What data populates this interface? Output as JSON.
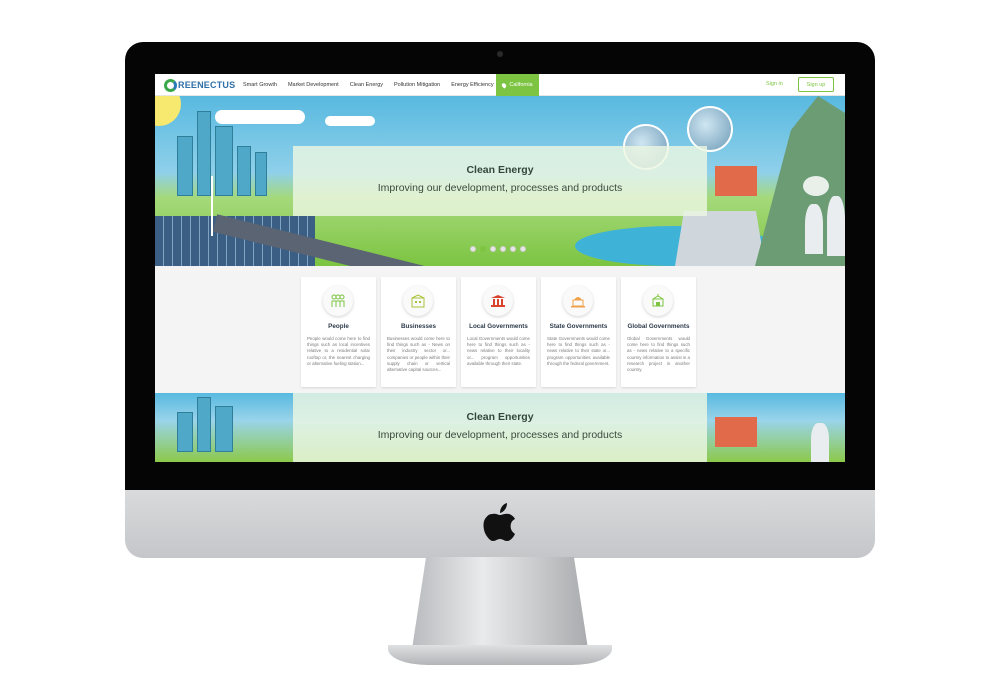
{
  "brand": {
    "logo_text": "REENECTUS",
    "accent": "#7cc441",
    "logo_blue": "#2f6fa8"
  },
  "nav": {
    "links": [
      "Smart Growth",
      "Market Development",
      "Clean Energy",
      "Pollution Mitigation",
      "Energy Efficiency"
    ],
    "location": "California",
    "signin": "Sign in",
    "signup": "Sign up"
  },
  "hero": {
    "title": "Clean Energy",
    "subtitle": "Improving our development, processes and products",
    "slide_count": 6,
    "active_slide": 1
  },
  "hero2": {
    "title": "Clean Energy",
    "subtitle": "Improving our development, processes and products"
  },
  "cards": [
    {
      "icon": "people-icon",
      "title": "People",
      "text": "People would come here to find things such as local incentives relative to a residential solar rooftop or, the nearest charging or alternative fueling station..."
    },
    {
      "icon": "business-icon",
      "title": "Businesses",
      "text": "Businesses would come here to find things such as - News on their industry sector or... companies or people within their supply chain or vertical alternative capital sources..."
    },
    {
      "icon": "local-government-icon",
      "title": "Local Governments",
      "text": "Local Governments would come here to find things such as - news relative to their locality or... program opportunities available through their state."
    },
    {
      "icon": "state-government-icon",
      "title": "State Governments",
      "text": "State Governments would come here to find things such as - news relative to their state or... program opportunities available through the federal government."
    },
    {
      "icon": "global-government-icon",
      "title": "Global Governments",
      "text": "Global Governments would come here to find things such as - news relative to a specific country information to assist in a research project in another country."
    }
  ]
}
